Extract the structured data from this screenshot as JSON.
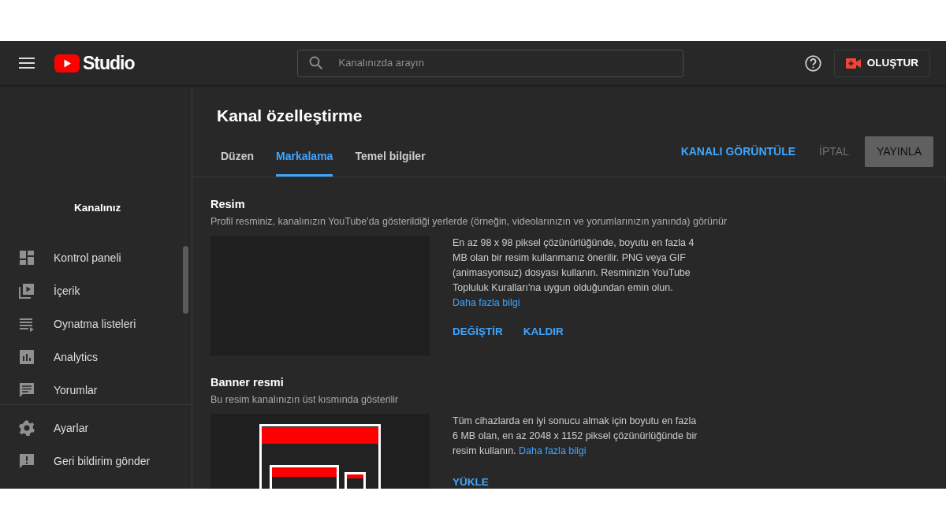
{
  "header": {
    "logo_text": "Studio",
    "search": {
      "placeholder": "Kanalınızda arayın"
    },
    "create_button": "OLUŞTUR"
  },
  "sidebar": {
    "channel_label": "Kanalınız",
    "items": [
      {
        "label": "Kontrol paneli",
        "kind": "dashboard"
      },
      {
        "label": "İçerik",
        "kind": "content"
      },
      {
        "label": "Oynatma listeleri",
        "kind": "playlist"
      },
      {
        "label": "Analytics",
        "kind": "analytics"
      },
      {
        "label": "Yorumlar",
        "kind": "comments"
      }
    ],
    "footer_items": [
      {
        "label": "Ayarlar",
        "kind": "settings"
      },
      {
        "label": "Geri bildirim gönder",
        "kind": "feedback"
      }
    ]
  },
  "page": {
    "title": "Kanal özelleştirme",
    "tabs": [
      {
        "label": "Düzen",
        "selected": false
      },
      {
        "label": "Markalama",
        "selected": true
      },
      {
        "label": "Temel bilgiler",
        "selected": false
      }
    ],
    "actions": [
      {
        "label": "KANALI GÖRÜNTÜLE",
        "kind": "link"
      },
      {
        "label": "İPTAL",
        "kind": "muted"
      },
      {
        "label": "YAYINLA",
        "kind": "filled"
      }
    ],
    "sections": [
      {
        "title": "Resim",
        "description": "Profil resminiz, kanalınızın YouTube'da gösterildiği yerlerde (örneğin, videolarınızın ve yorumlarınızın yanında) görünür",
        "kind": "photo",
        "info": "En az 98 x 98 piksel çözünürlüğünde, boyutu en fazla 4 MB olan bir resim kullanmanız önerilir. PNG veya GIF (animasyonsuz) dosyası kullanın. Resminizin YouTube Topluluk Kuralları'na uygun olduğundan emin olun.",
        "link": "Daha fazla bilgi",
        "buttons": [
          "DEĞİŞTİR",
          "KALDIR"
        ]
      },
      {
        "title": "Banner resmi",
        "description": "Bu resim kanalınızın üst kısmında gösterilir",
        "kind": "banner",
        "info": "Tüm cihazlarda en iyi sonucu almak için boyutu en fazla 6 MB olan, en az 2048 x 1152 piksel çözünürlüğünde bir resim kullanın.",
        "link": "Daha fazla bilgi",
        "buttons": [
          "YÜKLE"
        ]
      }
    ]
  }
}
